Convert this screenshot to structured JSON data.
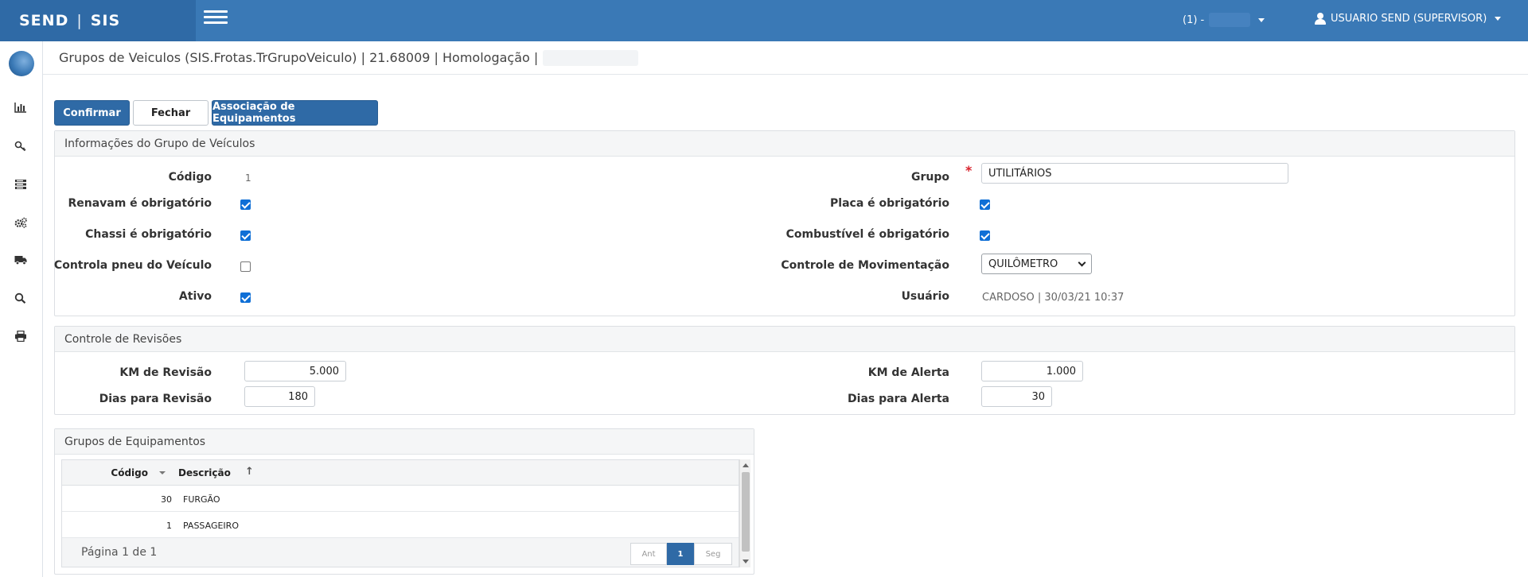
{
  "header": {
    "brand_left": "SEND",
    "brand_sep": "|",
    "brand_right": "SIS",
    "company": "(1) -",
    "user": "USUARIO SEND (SUPERVISOR)"
  },
  "sidebar": {
    "icons": [
      "logo-icon",
      "chart-icon",
      "key-icon",
      "list-icon",
      "gears-icon",
      "truck-icon",
      "search-icon",
      "print-icon"
    ]
  },
  "page": {
    "title": "Grupos de Veiculos (SIS.Frotas.TrGrupoVeiculo) | 21.68009 | Homologação |"
  },
  "toolbar": {
    "confirm": "Confirmar",
    "close": "Fechar",
    "equipment": "Associação de Equipamentos"
  },
  "info": {
    "title": "Informações do Grupo de Veículos",
    "codigo_label": "Código",
    "codigo_value": "1",
    "renavam_label": "Renavam é obrigatório",
    "renavam_checked": true,
    "chassi_label": "Chassi é obrigatório",
    "chassi_checked": true,
    "pneu_label": "Controla pneu do Veículo",
    "pneu_checked": false,
    "ativo_label": "Ativo",
    "ativo_checked": true,
    "grupo_label": "Grupo",
    "grupo_required": "*",
    "grupo_value": "UTILITÁRIOS",
    "placa_label": "Placa é obrigatório",
    "placa_checked": true,
    "combustivel_label": "Combustível é obrigatório",
    "combustivel_checked": true,
    "movimentacao_label": "Controle de Movimentação",
    "movimentacao_value": "QUILÔMETRO",
    "usuario_label": "Usuário",
    "usuario_value": "CARDOSO | 30/03/21 10:37"
  },
  "revisoes": {
    "title": "Controle de Revisões",
    "km_revisao_label": "KM de Revisão",
    "km_revisao_value": "5.000",
    "dias_revisao_label": "Dias para Revisão",
    "dias_revisao_value": "180",
    "km_alerta_label": "KM de Alerta",
    "km_alerta_value": "1.000",
    "dias_alerta_label": "Dias para Alerta",
    "dias_alerta_value": "30"
  },
  "equipamentos": {
    "title": "Grupos de Equipamentos",
    "col_codigo": "Código",
    "col_descricao": "Descrição",
    "rows": [
      {
        "codigo": "30",
        "descricao": "FURGÃO"
      },
      {
        "codigo": "1",
        "descricao": "PASSAGEIRO"
      }
    ],
    "page_info": "Página 1 de 1",
    "prev": "Ant",
    "current": "1",
    "next": "Seg"
  }
}
